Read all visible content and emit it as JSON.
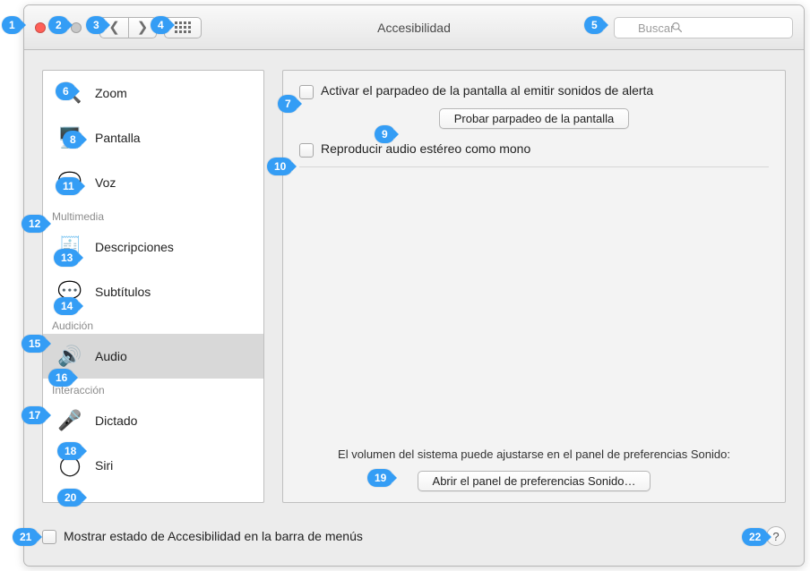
{
  "window": {
    "title": "Accesibilidad"
  },
  "search": {
    "placeholder": "Buscar"
  },
  "sidebar": {
    "items": [
      {
        "label": "Zoom",
        "iconName": "zoom-icon",
        "iconGlyph": "🔍"
      },
      {
        "label": "Pantalla",
        "iconName": "display-icon",
        "iconGlyph": "🖥️"
      },
      {
        "label": "Voz",
        "iconName": "speech-icon",
        "iconGlyph": "💬"
      }
    ],
    "multimediaHeader": "Multimedia",
    "multimediaItems": [
      {
        "label": "Descripciones",
        "iconName": "descriptions-icon",
        "iconGlyph": "🧾"
      },
      {
        "label": "Subtítulos",
        "iconName": "captions-icon",
        "iconGlyph": "💬"
      }
    ],
    "audicionHeader": "Audición",
    "audicionItems": [
      {
        "label": "Audio",
        "iconName": "audio-icon",
        "iconGlyph": "🔊"
      }
    ],
    "interaccionHeader": "Interacción",
    "interaccionItems": [
      {
        "label": "Dictado",
        "iconName": "dictation-icon",
        "iconGlyph": "🎤"
      },
      {
        "label": "Siri",
        "iconName": "siri-icon",
        "iconGlyph": "◯"
      }
    ]
  },
  "main": {
    "flashCheckboxLabel": "Activar el parpadeo de la pantalla al emitir sonidos de alerta",
    "testFlashButton": "Probar parpadeo de la pantalla",
    "monoCheckboxLabel": "Reproducir audio estéreo como mono",
    "volumeNote": "El volumen del sistema puede ajustarse en el panel de preferencias Sonido:",
    "openSoundButton": "Abrir el panel de preferencias Sonido…"
  },
  "footer": {
    "statusCheckboxLabel": "Mostrar estado de Accesibilidad en la barra de menús",
    "helpGlyph": "?"
  },
  "callouts": {
    "c1": "1",
    "c2": "2",
    "c3": "3",
    "c4": "4",
    "c5": "5",
    "c6": "6",
    "c7": "7",
    "c8": "8",
    "c9": "9",
    "c10": "10",
    "c11": "11",
    "c12": "12",
    "c13": "13",
    "c14": "14",
    "c15": "15",
    "c16": "16",
    "c17": "17",
    "c18": "18",
    "c19": "19",
    "c20": "20",
    "c21": "21",
    "c22": "22"
  }
}
